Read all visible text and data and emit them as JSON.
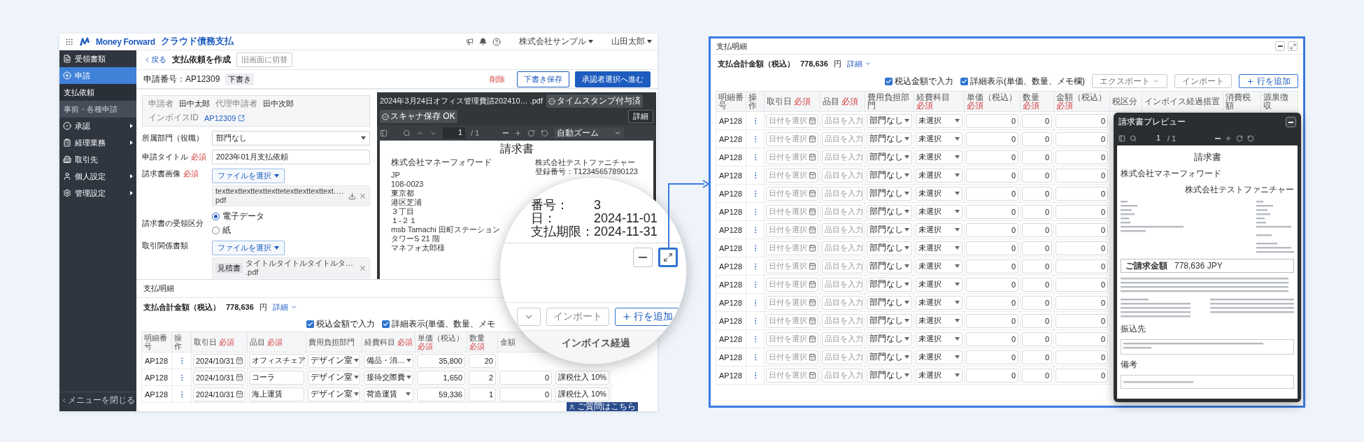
{
  "app_header": {
    "brand": "Money Forward",
    "product": "クラウド債務支払",
    "company": "株式会社サンプル",
    "user": "山田太郎"
  },
  "sidebar": {
    "items": [
      {
        "label": "受領書類",
        "selected": false,
        "submenu": false
      },
      {
        "label": "申請",
        "selected": true,
        "submenu": false,
        "children": [
          {
            "label": "支払依頼",
            "selected": true
          },
          {
            "label": "事前・各種申請",
            "selected": false
          }
        ]
      },
      {
        "label": "承認",
        "selected": false,
        "submenu": true
      },
      {
        "label": "経理業務",
        "selected": false,
        "submenu": true
      },
      {
        "label": "取引先",
        "selected": false,
        "submenu": false
      },
      {
        "label": "個人設定",
        "selected": false,
        "submenu": true
      },
      {
        "label": "管理設定",
        "selected": false,
        "submenu": true
      }
    ],
    "close_label": "メニューを閉じる"
  },
  "page_header": {
    "back": "戻る",
    "title": "支払依頼を作成",
    "switch_button": "旧画面に切替"
  },
  "application": {
    "number": "申請番号：AP12309",
    "status": "下書き",
    "actions": [
      {
        "kind": "danger",
        "label": "削除"
      },
      {
        "kind": "secondary",
        "label": "下書き保存"
      },
      {
        "kind": "primary",
        "label": "承認者選択へ進む"
      }
    ]
  },
  "info": {
    "requester_label": "申請者",
    "requester": "田中太郎",
    "proxy_label": "代理申請者",
    "proxy": "田中次郎",
    "invoice_id_label": "インボイスID",
    "invoice_id": "AP12309"
  },
  "form_fields": [
    {
      "kind": "select",
      "label": "所属部門（役職）",
      "value": "部門なし"
    },
    {
      "kind": "text",
      "label": "申請タイトル",
      "required_mark": "必須",
      "value": "2023年01月支払依頼"
    },
    {
      "kind": "file",
      "label": "請求書画像",
      "required_mark": "必須",
      "button": "ファイルを選択",
      "file": "texttexttexttexttexttetexttexttexttext….pdf",
      "downloadable": true
    },
    {
      "kind": "radio",
      "label": "請求書の受領区分",
      "options": [
        {
          "label": "電子データ",
          "selected": true
        },
        {
          "label": "紙",
          "selected": false
        }
      ]
    },
    {
      "kind": "file",
      "label": "取引関係書類",
      "button": "ファイルを選択",
      "tag": "見積書",
      "file": "タイトルタイトルタイトルタ… .pdf",
      "downloadable": false
    }
  ],
  "pdf_viewer": {
    "file_name": "2024年3月24日オフィス管理費請202410… .pdf",
    "badges": [
      "タイムスタンプ付与済",
      "スキャナ保存 OK"
    ],
    "detail_button": "詳細",
    "page": "1",
    "page_total": "/ 1",
    "zoom": "自動ズーム",
    "document": {
      "title": "請求書",
      "sender_lines": [
        "株式会社マネーフォワード",
        "JP",
        "108-0023",
        "東京都",
        "港区芝浦",
        "３丁目",
        "１-２１",
        "msb Tamachi 田町ステーションタワーS 21 階",
        "マネフォ太郎様"
      ],
      "recipient_lines": [
        "株式会社テストファニチャー",
        "登録番号：T12345657890123"
      ]
    }
  },
  "details_section": {
    "title": "支払明細",
    "total_label": "支払合計金額（税込）",
    "total": "778,636",
    "currency": "円",
    "detail_link": "詳細",
    "options": [
      {
        "label": "税込金額で入力",
        "checked": true
      },
      {
        "label": "詳細表示(単価、数量、メモ",
        "checked": true
      }
    ],
    "columns": [
      {
        "label": "明細番号"
      },
      {
        "label": "操作"
      },
      {
        "label": "取引日",
        "required_mark": "必須"
      },
      {
        "label": "品目",
        "required_mark": "必須"
      },
      {
        "label": "費用負担部門"
      },
      {
        "label": "経費科目",
        "required_mark": "必須"
      },
      {
        "label": "単価（税込）",
        "required_mark": "必須"
      },
      {
        "label": "数量",
        "required_mark": "必須"
      },
      {
        "label": "金額"
      }
    ],
    "rows": [
      {
        "id": "AP128",
        "date": "2024/10/31",
        "item": "オフィスチェア",
        "department": "デザイン室",
        "account": "備品・消…",
        "unit_price": "35,800",
        "quantity": "20"
      },
      {
        "id": "AP128",
        "date": "2024/10/31",
        "item": "コーラ",
        "department": "デザイン室",
        "account": "接待交際費",
        "unit_price": "1,650",
        "quantity": "2",
        "amount": "0",
        "tax": "課税仕入 10%"
      },
      {
        "id": "AP128",
        "date": "2024/10/31",
        "item": "海上運賃",
        "department": "デザイン室",
        "account": "荷造運賃",
        "unit_price": "59,336",
        "quantity": "1",
        "amount": "0",
        "tax": "課税仕入 10%"
      }
    ]
  },
  "help_button": "ご質問はこちら",
  "magnifier": {
    "invoice_lines": [
      {
        "label": "番号：",
        "value": "3"
      },
      {
        "label": "日：",
        "value": "2024-11-01"
      },
      {
        "label": "支払期限：",
        "value": "2024-11-31"
      }
    ],
    "expand_highlighted": true,
    "import_button": "インポート",
    "add_button": "行を追加",
    "column_header": "インボイス経過"
  },
  "expanded_panel": {
    "title": "支払明細",
    "total_label": "支払合計金額（税込）",
    "total": "778,636",
    "currency": "円",
    "detail_link": "詳細",
    "options": [
      {
        "label": "税込金額で入力",
        "checked": true
      },
      {
        "label": "詳細表示(単価、数量、メモ欄)",
        "checked": true
      }
    ],
    "buttons": [
      {
        "kind": "dropdown",
        "label": "エクスポート"
      },
      {
        "kind": "plain",
        "label": "インポート"
      },
      {
        "kind": "add",
        "label": "行を追加"
      }
    ],
    "columns": [
      {
        "label": "明細番号"
      },
      {
        "label": "操作"
      },
      {
        "label": "取引日",
        "required_mark": "必須"
      },
      {
        "label": "品目",
        "required_mark": "必須"
      },
      {
        "label": "費用負担部門"
      },
      {
        "label": "経費科目",
        "required_mark": "必須"
      },
      {
        "label": "単価（税込）",
        "required_mark": "必須"
      },
      {
        "label": "数量",
        "required_mark": "必須"
      },
      {
        "label": "金額（税込）",
        "required_mark": "必須"
      },
      {
        "label": "税区分"
      },
      {
        "label": "インボイス経過措置"
      },
      {
        "label": "消費税額"
      },
      {
        "label": "源泉徴収"
      }
    ],
    "rows": [
      {
        "id": "AP128",
        "date_placeholder": "日付を選択",
        "item_placeholder": "品目を入力",
        "department": "部門なし",
        "account": "未選択",
        "unit_price": "0",
        "quantity": "0",
        "amount": "0"
      },
      {
        "id": "AP128",
        "date_placeholder": "日付を選択",
        "item_placeholder": "品目を入力",
        "department": "部門なし",
        "account": "未選択",
        "unit_price": "0",
        "quantity": "0",
        "amount": "0"
      },
      {
        "id": "AP128",
        "date_placeholder": "日付を選択",
        "item_placeholder": "品目を入力",
        "department": "部門なし",
        "account": "未選択",
        "unit_price": "0",
        "quantity": "0",
        "amount": "0"
      },
      {
        "id": "AP128",
        "date_placeholder": "日付を選択",
        "item_placeholder": "品目を入力",
        "department": "部門なし",
        "account": "未選択",
        "unit_price": "0",
        "quantity": "0",
        "amount": "0"
      },
      {
        "id": "AP128",
        "date_placeholder": "日付を選択",
        "item_placeholder": "品目を入力",
        "department": "部門なし",
        "account": "未選択",
        "unit_price": "0",
        "quantity": "0",
        "amount": "0"
      },
      {
        "id": "AP128",
        "date_placeholder": "日付を選択",
        "item_placeholder": "品目を入力",
        "department": "部門なし",
        "account": "未選択",
        "unit_price": "0",
        "quantity": "0",
        "amount": "0"
      },
      {
        "id": "AP128",
        "date_placeholder": "日付を選択",
        "item_placeholder": "品目を入力",
        "department": "部門なし",
        "account": "未選択",
        "unit_price": "0",
        "quantity": "0",
        "amount": "0"
      },
      {
        "id": "AP128",
        "date_placeholder": "日付を選択",
        "item_placeholder": "品目を入力",
        "department": "部門なし",
        "account": "未選択",
        "unit_price": "0",
        "quantity": "0",
        "amount": "0"
      },
      {
        "id": "AP128",
        "date_placeholder": "日付を選択",
        "item_placeholder": "品目を入力",
        "department": "部門なし",
        "account": "未選択",
        "unit_price": "0",
        "quantity": "0",
        "amount": "0"
      },
      {
        "id": "AP128",
        "date_placeholder": "日付を選択",
        "item_placeholder": "品目を入力",
        "department": "部門なし",
        "account": "未選択",
        "unit_price": "0",
        "quantity": "0",
        "amount": "0"
      },
      {
        "id": "AP128",
        "date_placeholder": "日付を選択",
        "item_placeholder": "品目を入力",
        "department": "部門なし",
        "account": "未選択",
        "unit_price": "0",
        "quantity": "0",
        "amount": "0"
      },
      {
        "id": "AP128",
        "date_placeholder": "日付を選択",
        "item_placeholder": "品目を入力",
        "department": "部門なし",
        "account": "未選択",
        "unit_price": "0",
        "quantity": "0",
        "amount": "0"
      },
      {
        "id": "AP128",
        "date_placeholder": "日付を選択",
        "item_placeholder": "品目を入力",
        "department": "部門なし",
        "account": "未選択",
        "unit_price": "0",
        "quantity": "0",
        "amount": "0"
      },
      {
        "id": "AP128",
        "date_placeholder": "日付を選択",
        "item_placeholder": "品目を入力",
        "department": "部門なし",
        "account": "未選択",
        "unit_price": "0",
        "quantity": "0",
        "amount": "0"
      },
      {
        "id": "AP128",
        "date_placeholder": "日付を選択",
        "item_placeholder": "品目を入力",
        "department": "部門なし",
        "account": "未選択",
        "unit_price": "0",
        "quantity": "0",
        "amount": "0"
      }
    ],
    "preview": {
      "title": "請求書プレビュー",
      "page": "1",
      "page_total": "/ 1",
      "document": {
        "title": "請求書",
        "sender": "株式会社マネーフォワード",
        "recipient": "株式会社テストファニチャー",
        "amount_label": "ご請求金額",
        "amount": "778,636 JPY",
        "bank_label": "振込先",
        "note_label": "備考"
      }
    }
  }
}
